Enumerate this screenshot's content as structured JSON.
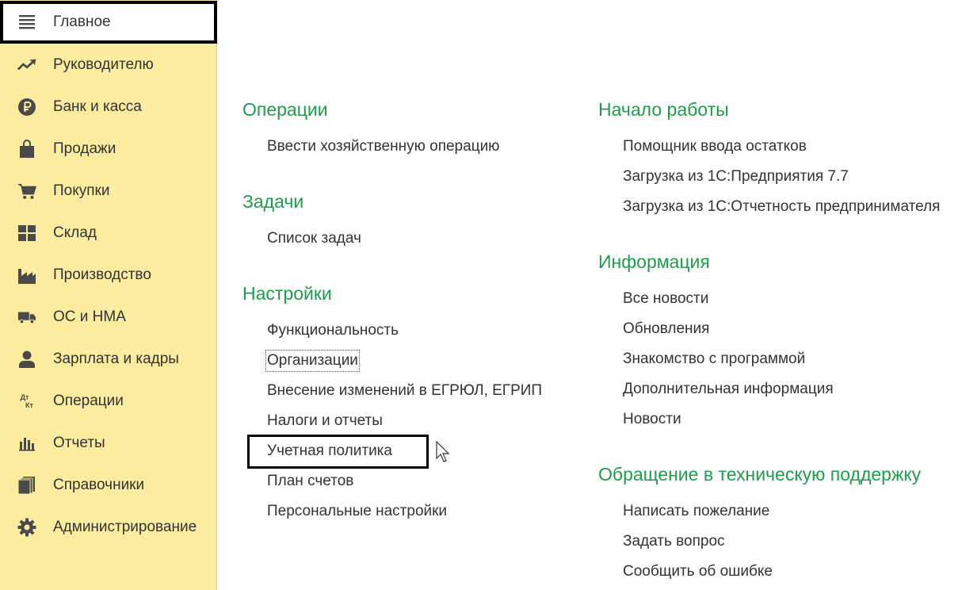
{
  "sidebar": {
    "items": [
      {
        "label": "Главное",
        "icon": "menu-lines-icon"
      },
      {
        "label": "Руководителю",
        "icon": "trend-up-icon"
      },
      {
        "label": "Банк и касса",
        "icon": "ruble-coin-icon"
      },
      {
        "label": "Продажи",
        "icon": "shopping-bag-icon"
      },
      {
        "label": "Покупки",
        "icon": "shopping-cart-icon"
      },
      {
        "label": "Склад",
        "icon": "warehouse-grid-icon"
      },
      {
        "label": "Производство",
        "icon": "factory-icon"
      },
      {
        "label": "ОС и НМА",
        "icon": "truck-icon"
      },
      {
        "label": "Зарплата и кадры",
        "icon": "person-icon"
      },
      {
        "label": "Операции",
        "icon": "dt-kt-icon",
        "icon_text_top": "Дт",
        "icon_text_bottom": "Кт"
      },
      {
        "label": "Отчеты",
        "icon": "bar-chart-icon"
      },
      {
        "label": "Справочники",
        "icon": "books-icon"
      },
      {
        "label": "Администрирование",
        "icon": "gear-icon"
      }
    ]
  },
  "main": {
    "left": {
      "operations": {
        "title": "Операции",
        "links": [
          "Ввести хозяйственную операцию"
        ]
      },
      "tasks": {
        "title": "Задачи",
        "links": [
          "Список задач"
        ]
      },
      "settings": {
        "title": "Настройки",
        "links": [
          "Функциональность",
          "Организации",
          "Внесение изменений в ЕГРЮЛ, ЕГРИП",
          "Налоги и отчеты",
          "Учетная политика",
          "План счетов",
          "Персональные настройки"
        ]
      }
    },
    "right": {
      "start": {
        "title": "Начало работы",
        "links": [
          "Помощник ввода остатков",
          "Загрузка из 1С:Предприятия 7.7",
          "Загрузка из 1С:Отчетность предпринимателя"
        ]
      },
      "info": {
        "title": "Информация",
        "links": [
          "Все новости",
          "Обновления",
          "Знакомство с программой",
          "Дополнительная информация",
          "Новости"
        ]
      },
      "support": {
        "title": "Обращение в техническую поддержку",
        "links": [
          "Написать пожелание",
          "Задать вопрос",
          "Сообщить об ошибке"
        ]
      }
    }
  },
  "colors": {
    "sidebar_bg": "#fbec9f",
    "section_title": "#1d9c4c",
    "text": "#333333",
    "icon": "#4a4a4a"
  }
}
